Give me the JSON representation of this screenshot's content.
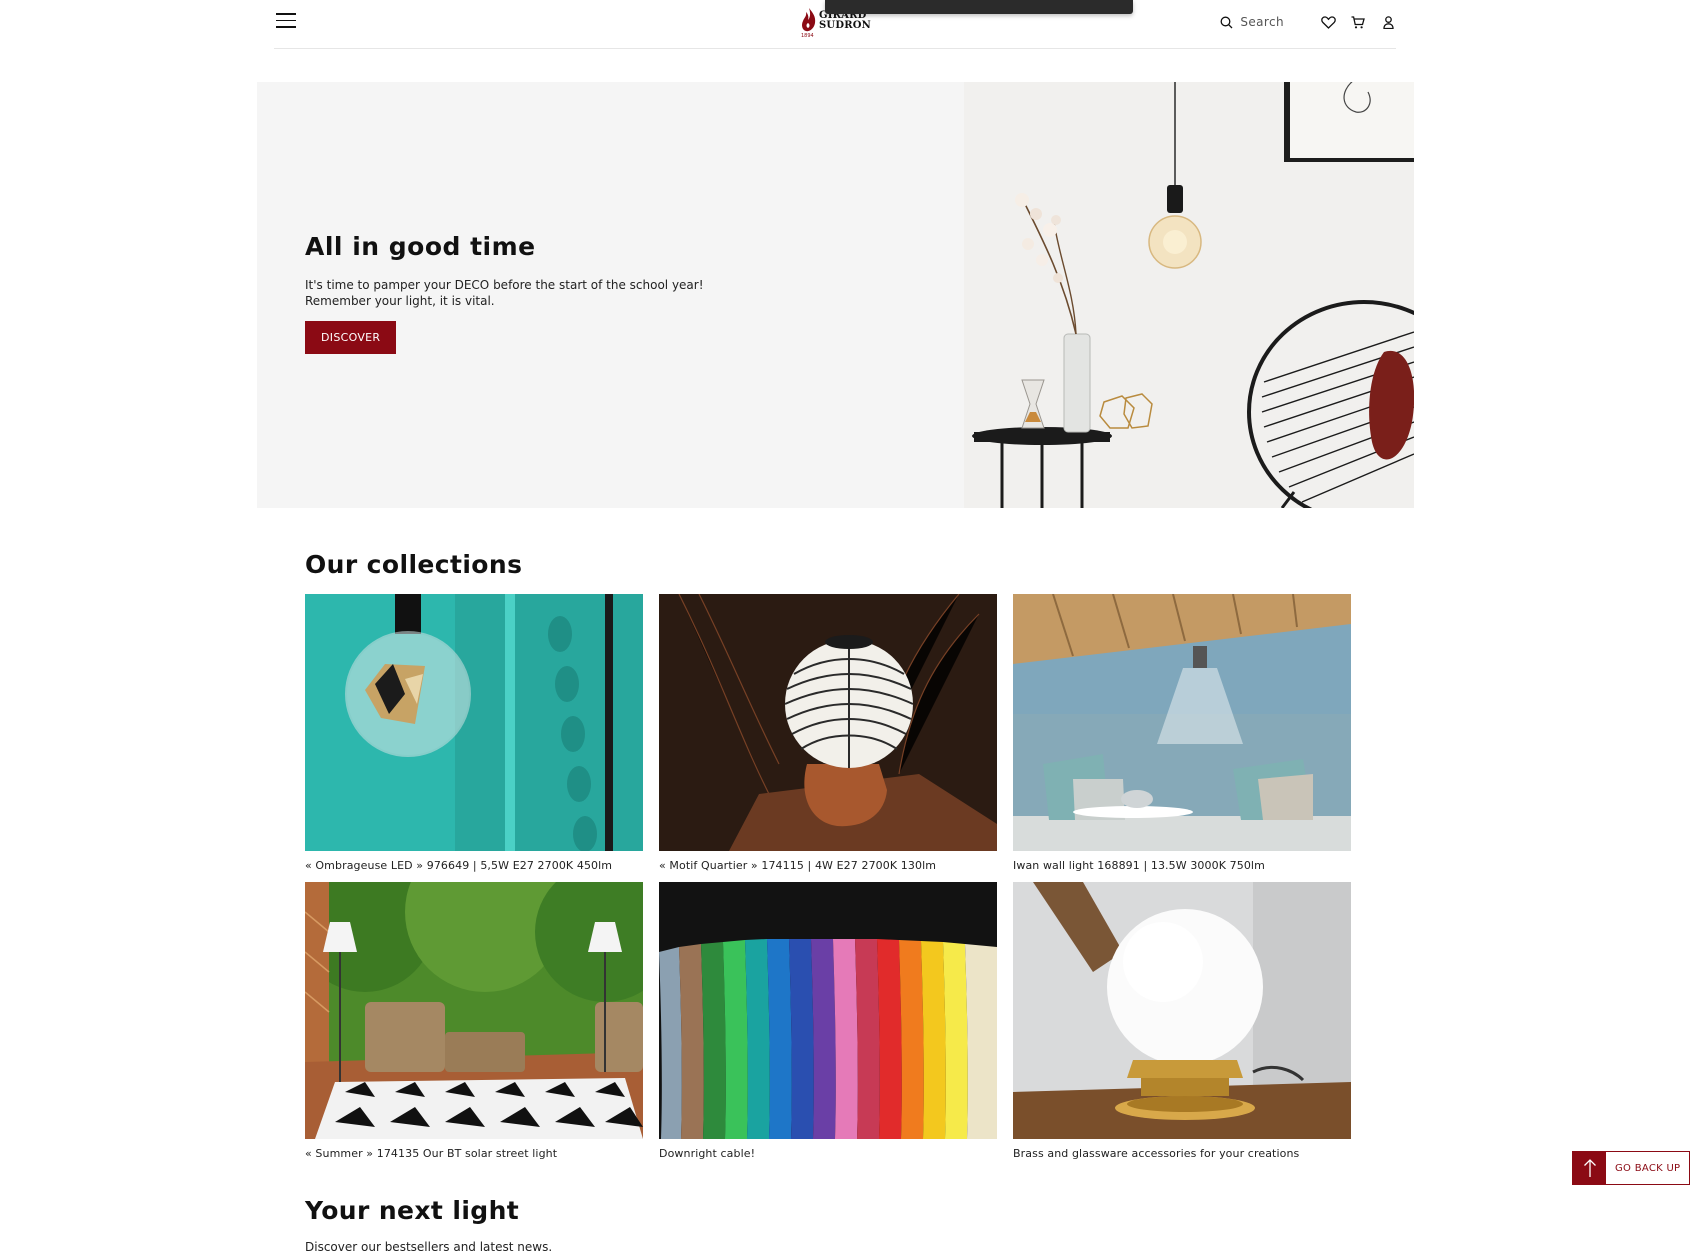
{
  "header": {
    "brand_line1": "GIRARD",
    "brand_line2": "SUDRON",
    "brand_year": "1894",
    "search_label": "Search",
    "brand_color": "#8b0a14"
  },
  "hero": {
    "title": "All in good time",
    "description": "It's time to pamper your DECO before the start of the school year!\nRemember your light, it is vital.",
    "button_label": "DISCOVER"
  },
  "collections": {
    "title": "Our collections",
    "items": [
      {
        "caption": "« Ombrageuse LED » 976649 | 5,5W E27 2700K 450lm"
      },
      {
        "caption": "« Motif Quartier » 174115 | 4W E27 2700K 130lm"
      },
      {
        "caption": "Iwan wall light 168891 | 13.5W 3000K 750lm"
      },
      {
        "caption": "« Summer » 174135 Our BT solar street light"
      },
      {
        "caption": "Downright cable!"
      },
      {
        "caption": "Brass and glassware accessories for your creations"
      }
    ]
  },
  "next_light": {
    "title": "Your next light",
    "subtitle": "Discover our bestsellers and latest news."
  },
  "back_to_top": {
    "label": "GO BACK UP"
  }
}
